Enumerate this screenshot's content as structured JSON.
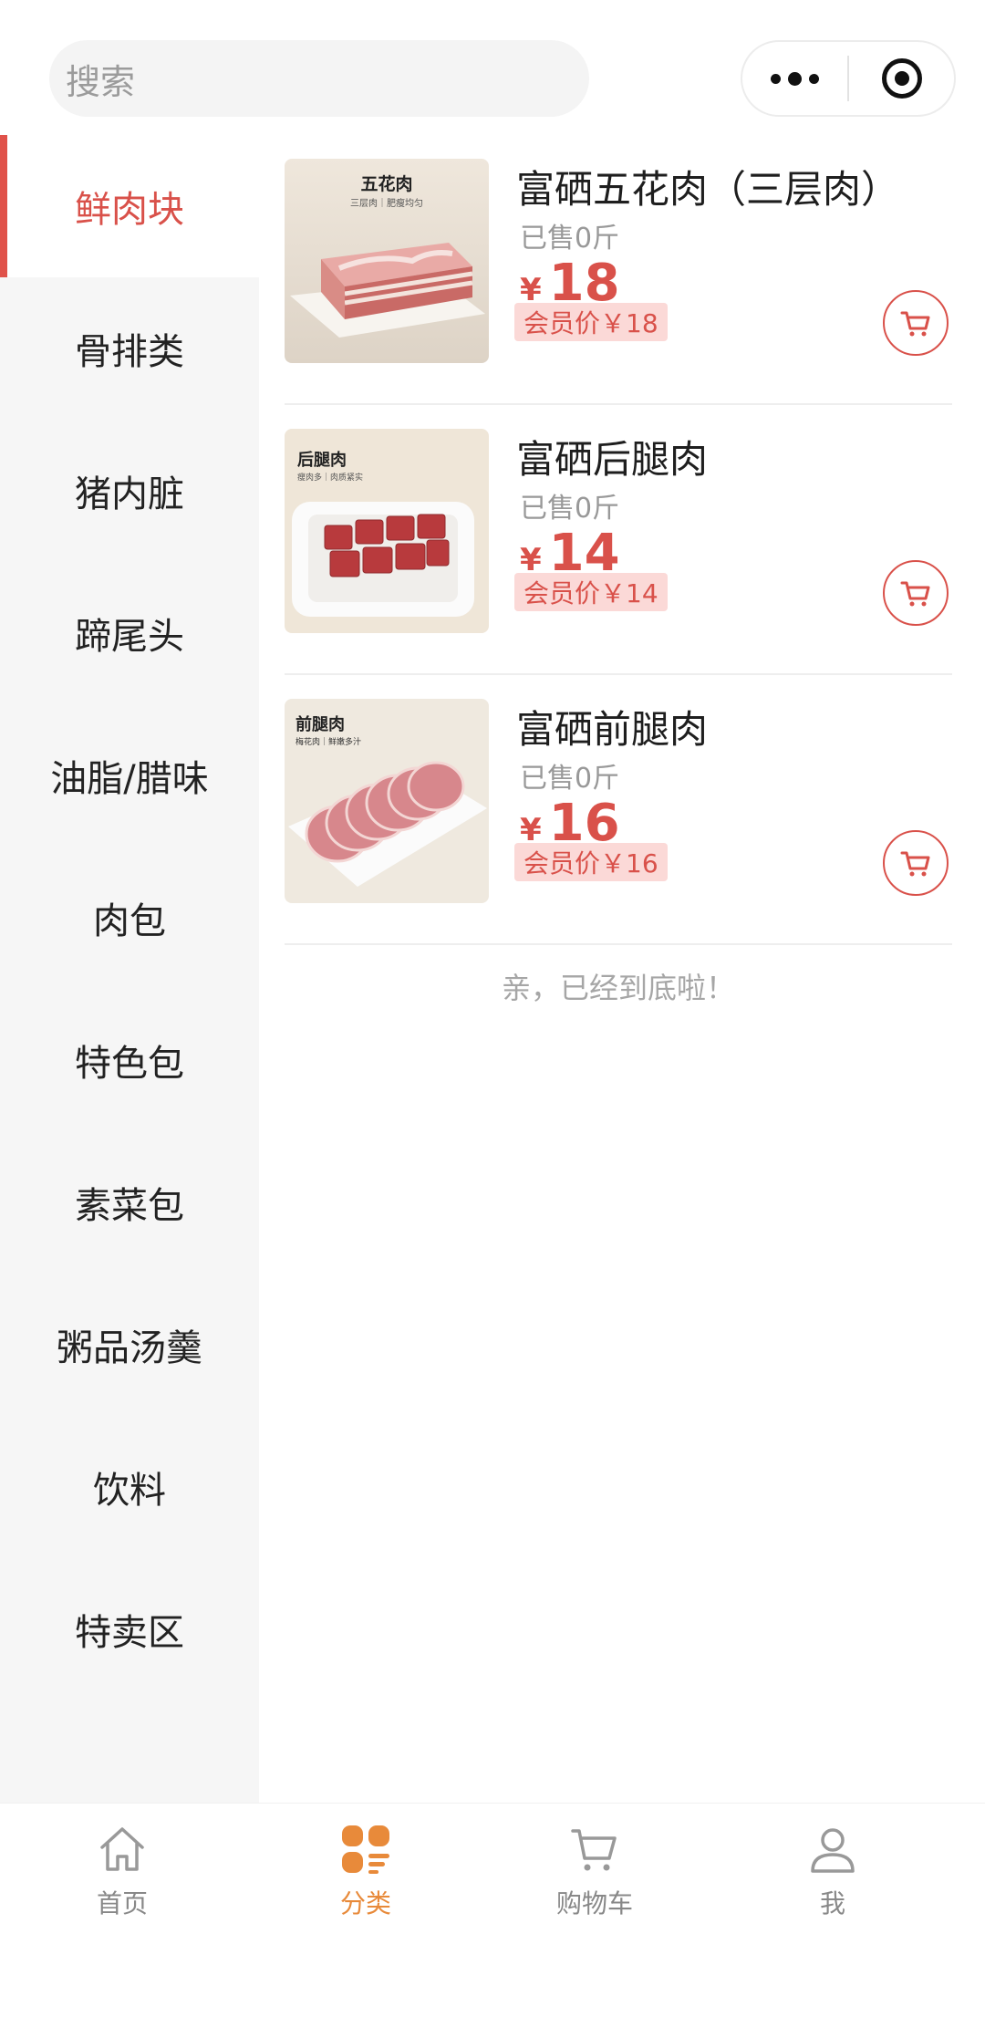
{
  "search": {
    "placeholder": "搜索"
  },
  "sidebar": {
    "items": [
      {
        "label": "鲜肉块",
        "active": true
      },
      {
        "label": "骨排类"
      },
      {
        "label": "猪内脏"
      },
      {
        "label": "蹄尾头"
      },
      {
        "label": "油脂/腊味"
      },
      {
        "label": "肉包"
      },
      {
        "label": "特色包"
      },
      {
        "label": "素菜包"
      },
      {
        "label": "粥品汤羹"
      },
      {
        "label": "饮料"
      },
      {
        "label": "特卖区"
      }
    ]
  },
  "products": [
    {
      "name": "富硒五花肉（三层肉）",
      "sold": "已售0斤",
      "currency": "¥",
      "price": "18",
      "member_price": "会员价￥18",
      "image_title": "五花肉",
      "image_subtitle": "三层肉｜肥瘦均匀"
    },
    {
      "name": "富硒后腿肉",
      "sold": "已售0斤",
      "currency": "¥",
      "price": "14",
      "member_price": "会员价￥14",
      "image_title": "后腿肉",
      "image_subtitle": "瘦肉多｜肉质紧实"
    },
    {
      "name": "富硒前腿肉",
      "sold": "已售0斤",
      "currency": "¥",
      "price": "16",
      "member_price": "会员价￥16",
      "image_title": "前腿肉",
      "image_subtitle": "梅花肉｜鲜嫩多汁"
    }
  ],
  "end_text": "亲，已经到底啦！",
  "tabbar": {
    "items": [
      {
        "label": "首页",
        "icon": "home-icon"
      },
      {
        "label": "分类",
        "icon": "category-icon",
        "active": true
      },
      {
        "label": "购物车",
        "icon": "cart-icon"
      },
      {
        "label": "我",
        "icon": "user-icon"
      }
    ]
  },
  "colors": {
    "accent": "#d9514a",
    "tab_active": "#e88a3a",
    "member_bg": "#fbd9d7",
    "sidebar_bg": "#f6f6f6"
  }
}
